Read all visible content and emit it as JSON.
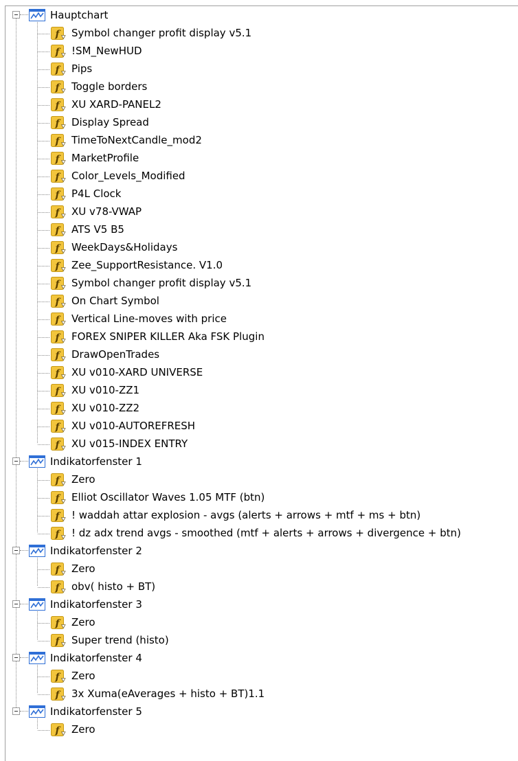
{
  "tree": {
    "groups": [
      {
        "label": "Hauptchart",
        "items": [
          "Symbol changer profit display v5.1",
          "!SM_NewHUD",
          "Pips",
          "Toggle borders",
          "XU XARD-PANEL2",
          "Display Spread",
          "TimeToNextCandle_mod2",
          "MarketProfile",
          "Color_Levels_Modified",
          "P4L Clock",
          "XU v78-VWAP",
          "ATS V5 B5",
          "WeekDays&Holidays",
          "Zee_SupportResistance. V1.0",
          "Symbol changer profit display v5.1",
          "On Chart Symbol",
          "Vertical Line-moves with price",
          "FOREX SNIPER KILLER Aka FSK Plugin",
          "DrawOpenTrades",
          "XU v010-XARD UNIVERSE",
          "XU v010-ZZ1",
          "XU v010-ZZ2",
          "XU v010-AUTOREFRESH",
          "XU v015-INDEX ENTRY"
        ]
      },
      {
        "label": "Indikatorfenster 1",
        "items": [
          "Zero",
          "Elliot Oscillator Waves 1.05 MTF (btn)",
          "! waddah attar explosion - avgs (alerts + arrows + mtf + ms + btn)",
          "! dz adx trend avgs - smoothed (mtf + alerts + arrows + divergence + btn)"
        ]
      },
      {
        "label": "Indikatorfenster 2",
        "items": [
          "Zero",
          "obv( histo + BT)"
        ]
      },
      {
        "label": "Indikatorfenster 3",
        "items": [
          "Zero",
          "Super trend (histo)"
        ]
      },
      {
        "label": "Indikatorfenster 4",
        "items": [
          "Zero",
          "3x Xuma(eAverages + histo + BT)1.1"
        ]
      },
      {
        "label": "Indikatorfenster 5",
        "items": [
          "Zero"
        ]
      }
    ]
  },
  "icons": {
    "group": "chart-window-icon",
    "item": "custom-indicator-icon"
  },
  "colors": {
    "window_blue": "#2f6fd6",
    "indicator_gold": "#f2c53d",
    "indicator_border": "#c79a16",
    "tree_lines": "#8a8a8a"
  }
}
